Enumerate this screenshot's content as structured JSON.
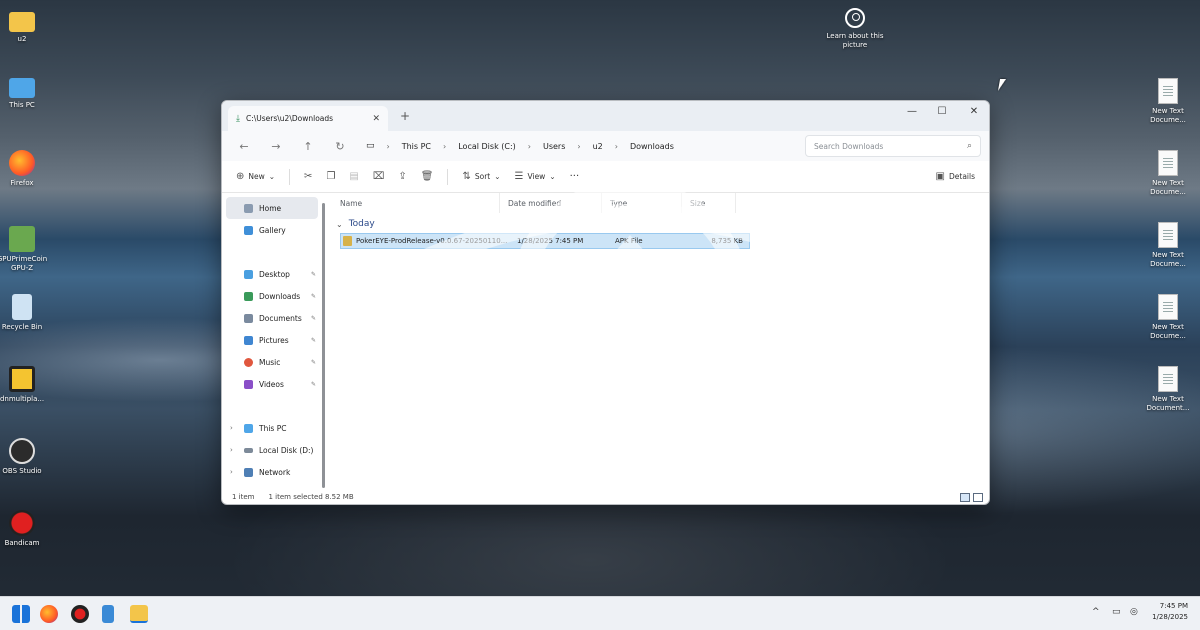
{
  "desktop": {
    "left_icons": [
      {
        "label": "u2",
        "icon": "folder-icon"
      },
      {
        "label": "This PC",
        "icon": "monitor-icon"
      },
      {
        "label": "Firefox",
        "icon": "firefox-icon"
      },
      {
        "label": "GPUPrimeCoin GPU-Z",
        "icon": "app-icon"
      },
      {
        "label": "Recycle Bin",
        "icon": "recycle-bin-icon"
      },
      {
        "label": "dnmultipla...",
        "icon": "app-icon"
      },
      {
        "label": "OBS Studio",
        "icon": "obs-icon"
      },
      {
        "label": "Bandicam",
        "icon": "bandicam-icon"
      }
    ],
    "right_icons": [
      {
        "label": "New Text Docume..."
      },
      {
        "label": "New Text Docume..."
      },
      {
        "label": "New Text Docume..."
      },
      {
        "label": "New Text Docume..."
      },
      {
        "label": "New Text Document..."
      }
    ],
    "learn_about": "Learn about this picture"
  },
  "window": {
    "tab_title": "C:\\Users\\u2\\Downloads",
    "breadcrumbs": [
      "This PC",
      "Local Disk (C:)",
      "Users",
      "u2",
      "Downloads"
    ],
    "search_placeholder": "Search Downloads",
    "commands": {
      "new": "New",
      "sort": "Sort",
      "view": "View",
      "more": "···",
      "details": "Details"
    },
    "sidebar": [
      {
        "label": "Home",
        "active": true
      },
      {
        "label": "Gallery"
      },
      {
        "label": "Desktop",
        "pinned": true
      },
      {
        "label": "Downloads",
        "pinned": true
      },
      {
        "label": "Documents",
        "pinned": true
      },
      {
        "label": "Pictures",
        "pinned": true
      },
      {
        "label": "Music",
        "pinned": true
      },
      {
        "label": "Videos",
        "pinned": true
      },
      {
        "label": "This PC",
        "expandable": true
      },
      {
        "label": "Local Disk (D:)",
        "expandable": true
      },
      {
        "label": "Network",
        "expandable": true
      }
    ],
    "columns": [
      "Name",
      "Date modified",
      "Type",
      "Size"
    ],
    "group_label": "Today",
    "files": [
      {
        "name": "PokerEYE-ProdRelease-v0.0.67-20250110...",
        "date": "1/28/2025 7:45 PM",
        "type": "APK File",
        "size": "8,735 KB"
      }
    ],
    "status": {
      "count": "1 item",
      "selected": "1 item selected  8.52 MB"
    }
  },
  "taskbar": {
    "time": "7:45 PM",
    "date": "1/28/2025"
  },
  "colors": {
    "selection": "#cce4f7",
    "accent": "#0067c0"
  }
}
